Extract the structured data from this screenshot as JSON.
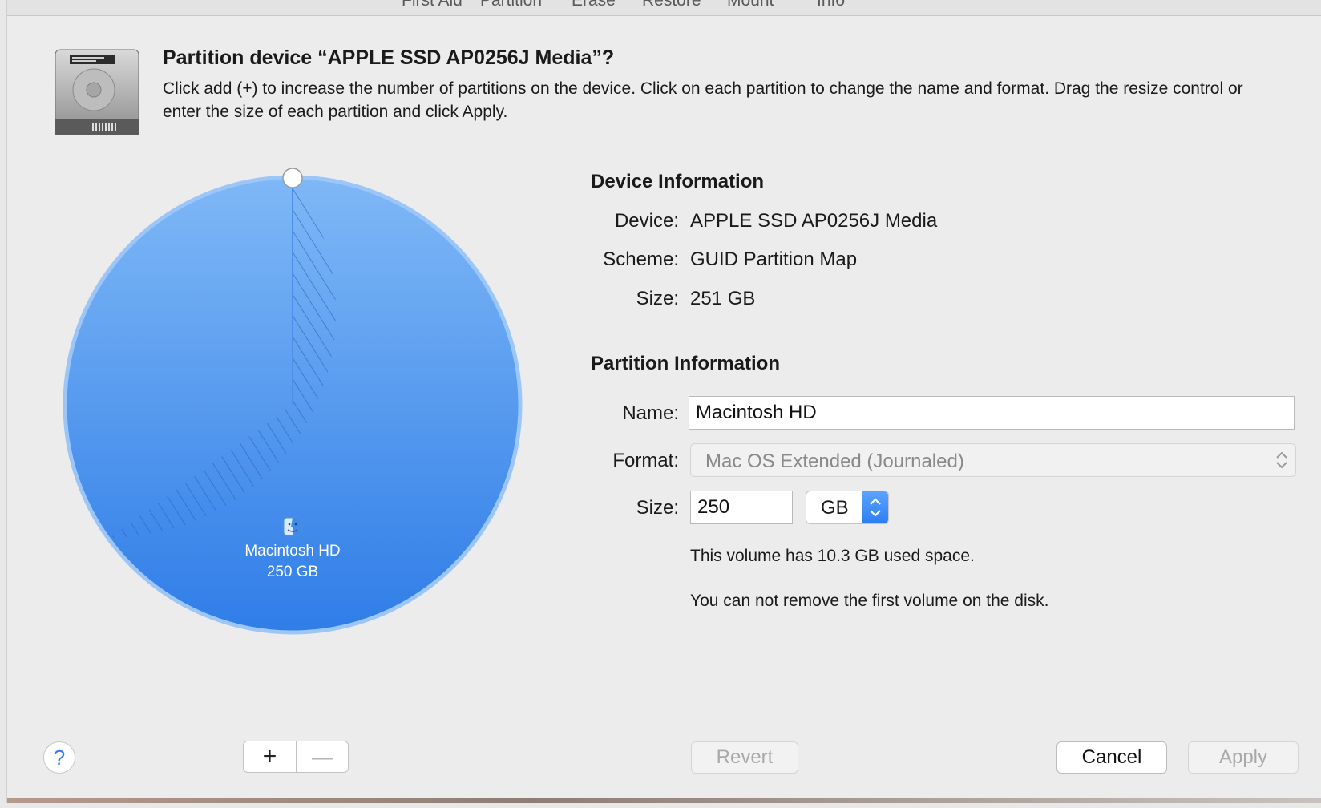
{
  "toolbar": {
    "tabs": [
      "First Aid",
      "Partition",
      "Erase",
      "Restore",
      "Mount",
      "Info"
    ]
  },
  "dialog": {
    "title": "Partition device “APPLE SSD AP0256J Media”?",
    "subtitle": "Click add (+) to increase the number of partitions on the device. Click on each partition to change the name and format. Drag the resize control or enter the size of each partition and click Apply."
  },
  "pie": {
    "partition_name": "Macintosh HD",
    "partition_size": "250 GB",
    "used_fraction": 0.041,
    "colors": {
      "fill": "#5aa0f2",
      "stroke": "#8fbdf5",
      "hatch": "#2a6fd6"
    }
  },
  "device_info": {
    "heading": "Device Information",
    "device_label": "Device:",
    "device_value": "APPLE SSD AP0256J Media",
    "scheme_label": "Scheme:",
    "scheme_value": "GUID Partition Map",
    "size_label": "Size:",
    "size_value": "251 GB"
  },
  "partition_info": {
    "heading": "Partition Information",
    "name_label": "Name:",
    "name_value": "Macintosh HD",
    "format_label": "Format:",
    "format_value": "Mac OS Extended (Journaled)",
    "size_label": "Size:",
    "size_value": "250",
    "unit_value": "GB",
    "used_note": "This volume has 10.3 GB used space.",
    "remove_note": "You can not remove the first volume on the disk."
  },
  "buttons": {
    "help": "?",
    "add": "+",
    "remove": "—",
    "revert": "Revert",
    "cancel": "Cancel",
    "apply": "Apply"
  }
}
